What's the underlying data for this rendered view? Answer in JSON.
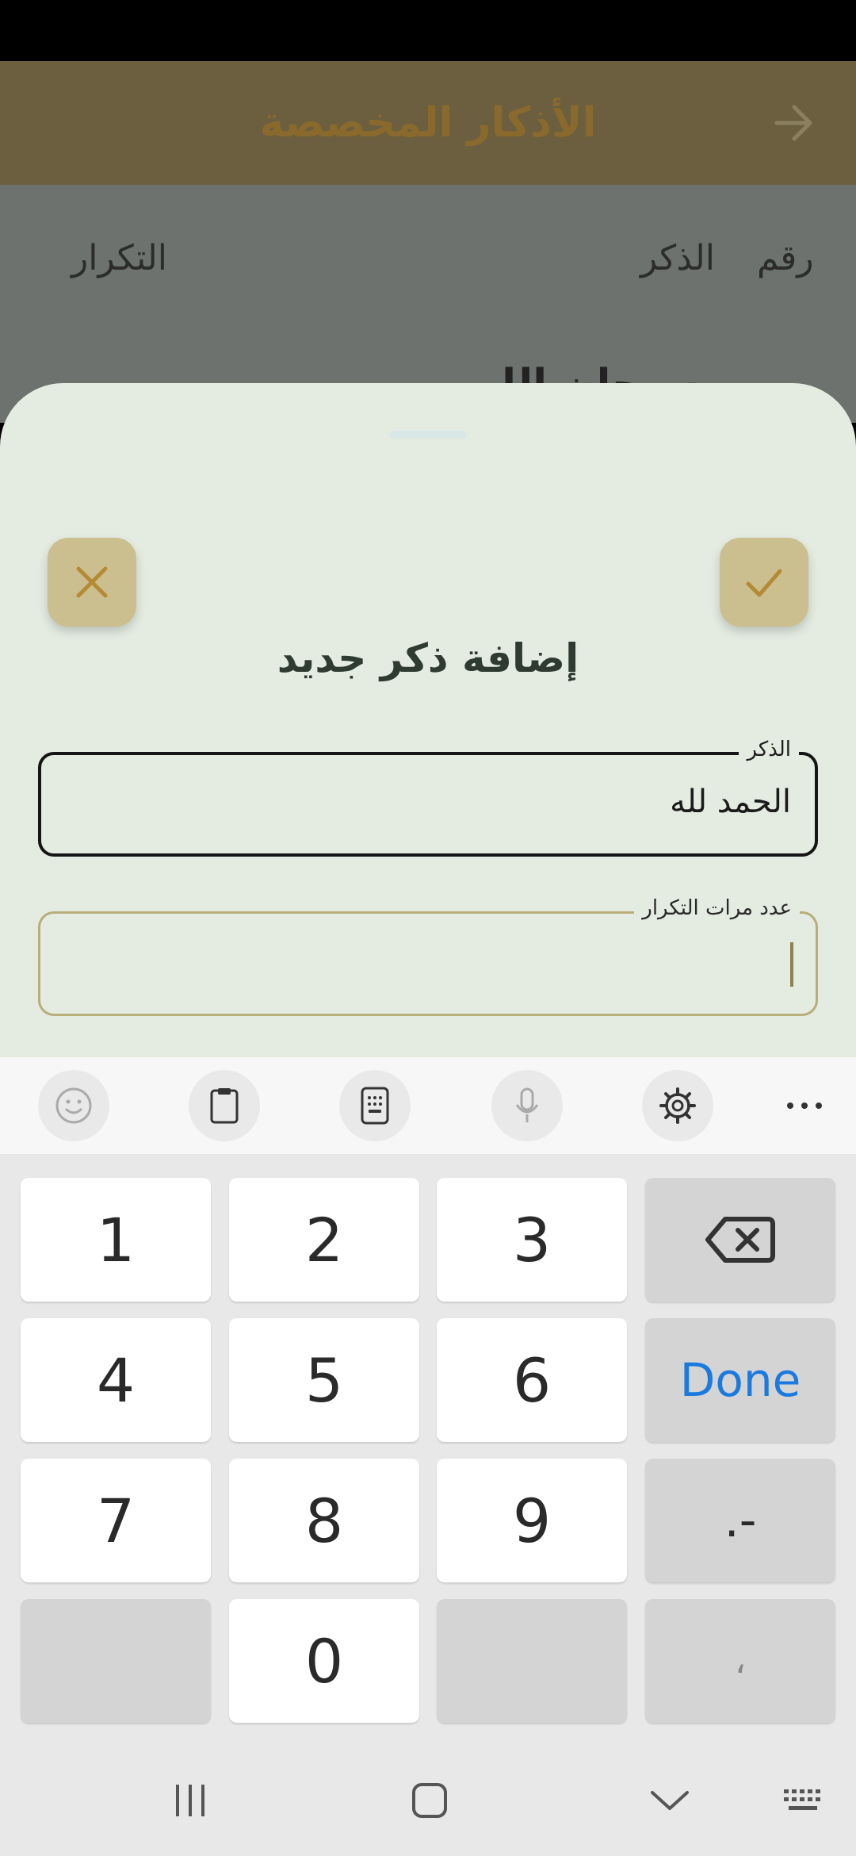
{
  "app_bar": {
    "title": "الأذكار المخصصة"
  },
  "table_header": {
    "number": "رقم",
    "dhikr": "الذكر",
    "repeat": "التكرار"
  },
  "list_peek": {
    "first_item": "سبحان الله"
  },
  "dialog": {
    "title": "إضافة ذكر جديد",
    "fields": {
      "dhikr": {
        "label": "الذكر",
        "value": "الحمد لله"
      },
      "count": {
        "label": "عدد مرات التكرار",
        "value": ""
      }
    }
  },
  "keyboard": {
    "toolbar": [
      "emoji-icon",
      "clipboard-icon",
      "keypad-icon",
      "microphone-icon",
      "settings-icon",
      "more-icon"
    ],
    "keys": {
      "k1": "1",
      "k2": "2",
      "k3": "3",
      "k4": "4",
      "k5": "5",
      "k6": "6",
      "k7": "7",
      "k8": "8",
      "k9": "9",
      "k0": "0",
      "done": "Done",
      "minus_dot": ".-",
      "comma": "،"
    }
  },
  "colors": {
    "accent": "#cbbf8f",
    "sheet": "#e4ece2",
    "app_bar": "#6b5f3f",
    "done": "#1a7ae0"
  }
}
